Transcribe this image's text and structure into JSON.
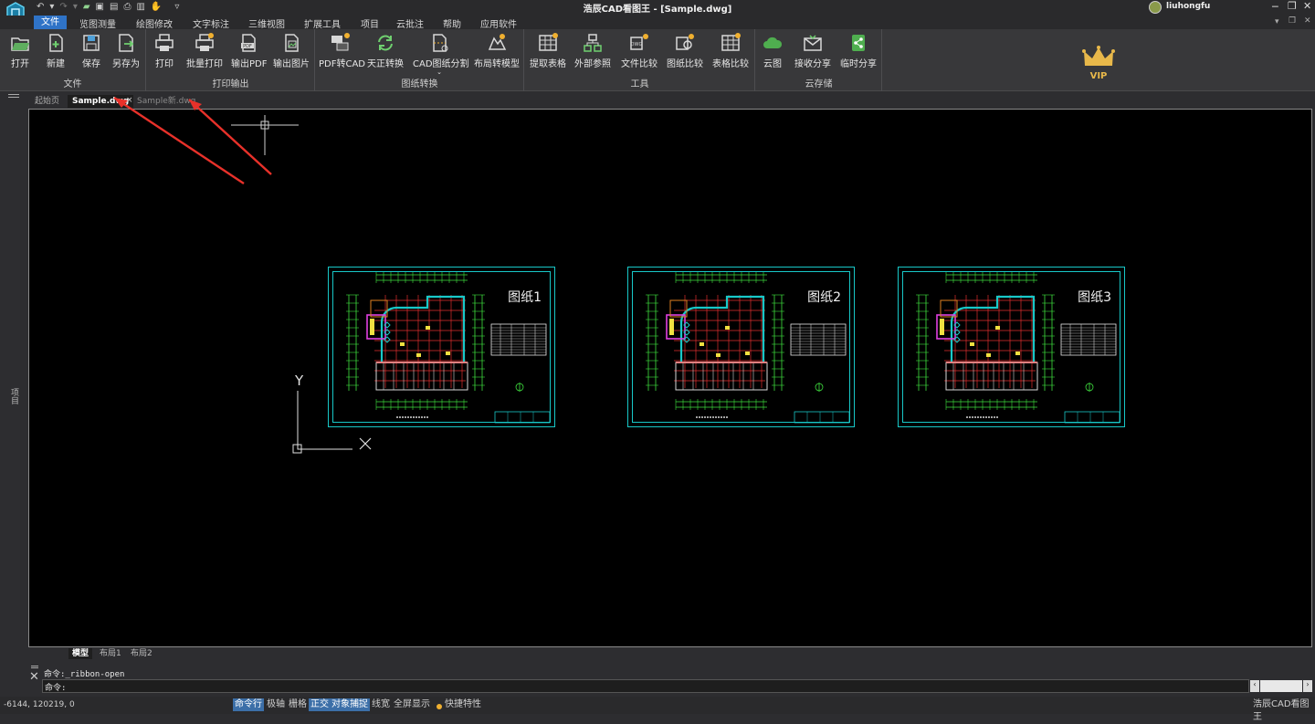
{
  "app": {
    "title": "浩辰CAD看图王 - [Sample.dwg]",
    "user": "liuhongfu"
  },
  "menu": [
    "文件",
    "览图测量",
    "绘图修改",
    "文字标注",
    "三维视图",
    "扩展工具",
    "项目",
    "云批注",
    "帮助",
    "应用软件"
  ],
  "ribbon": {
    "groups": [
      {
        "label": "文件",
        "buttons": [
          "打开",
          "新建",
          "保存",
          "另存为"
        ]
      },
      {
        "label": "打印输出",
        "buttons": [
          "打印",
          "批量打印",
          "输出PDF",
          "输出图片"
        ]
      },
      {
        "label": "图纸转换",
        "buttons": [
          "PDF转CAD",
          "天正转换",
          "CAD图纸分割",
          "布局转模型"
        ]
      },
      {
        "label": "工具",
        "buttons": [
          "提取表格",
          "外部参照",
          "文件比较",
          "图纸比较",
          "表格比较"
        ]
      },
      {
        "label": "云存储",
        "buttons": [
          "云图",
          "接收分享",
          "临时分享"
        ]
      }
    ],
    "vip": "VIP"
  },
  "doc_tabs": [
    "起始页",
    "Sample.dwg",
    "Sample新.dwg"
  ],
  "left_strip_label": "项目",
  "drawing": {
    "sheets": [
      "图纸1",
      "图纸2",
      "图纸3"
    ],
    "ucs_y": "Y",
    "ucs_x": "X"
  },
  "layout_tabs": [
    "模型",
    "布局1",
    "布局2"
  ],
  "command": {
    "line1": "命令:_ribbon-open",
    "line2": "命令:"
  },
  "status": {
    "coords": "-6144, 120219, 0",
    "toggles": [
      "命令行",
      "极轴",
      "栅格",
      "正交",
      "对象捕捉",
      "线宽",
      "全屏显示"
    ],
    "on": [
      true,
      false,
      false,
      true,
      true,
      false,
      false
    ],
    "quick": "快捷特性",
    "brand": "浩辰CAD看图王"
  },
  "colors": {
    "accent": "#2f73c7",
    "sheet_border": "#18c8c8",
    "arrow": "#e8312a"
  }
}
